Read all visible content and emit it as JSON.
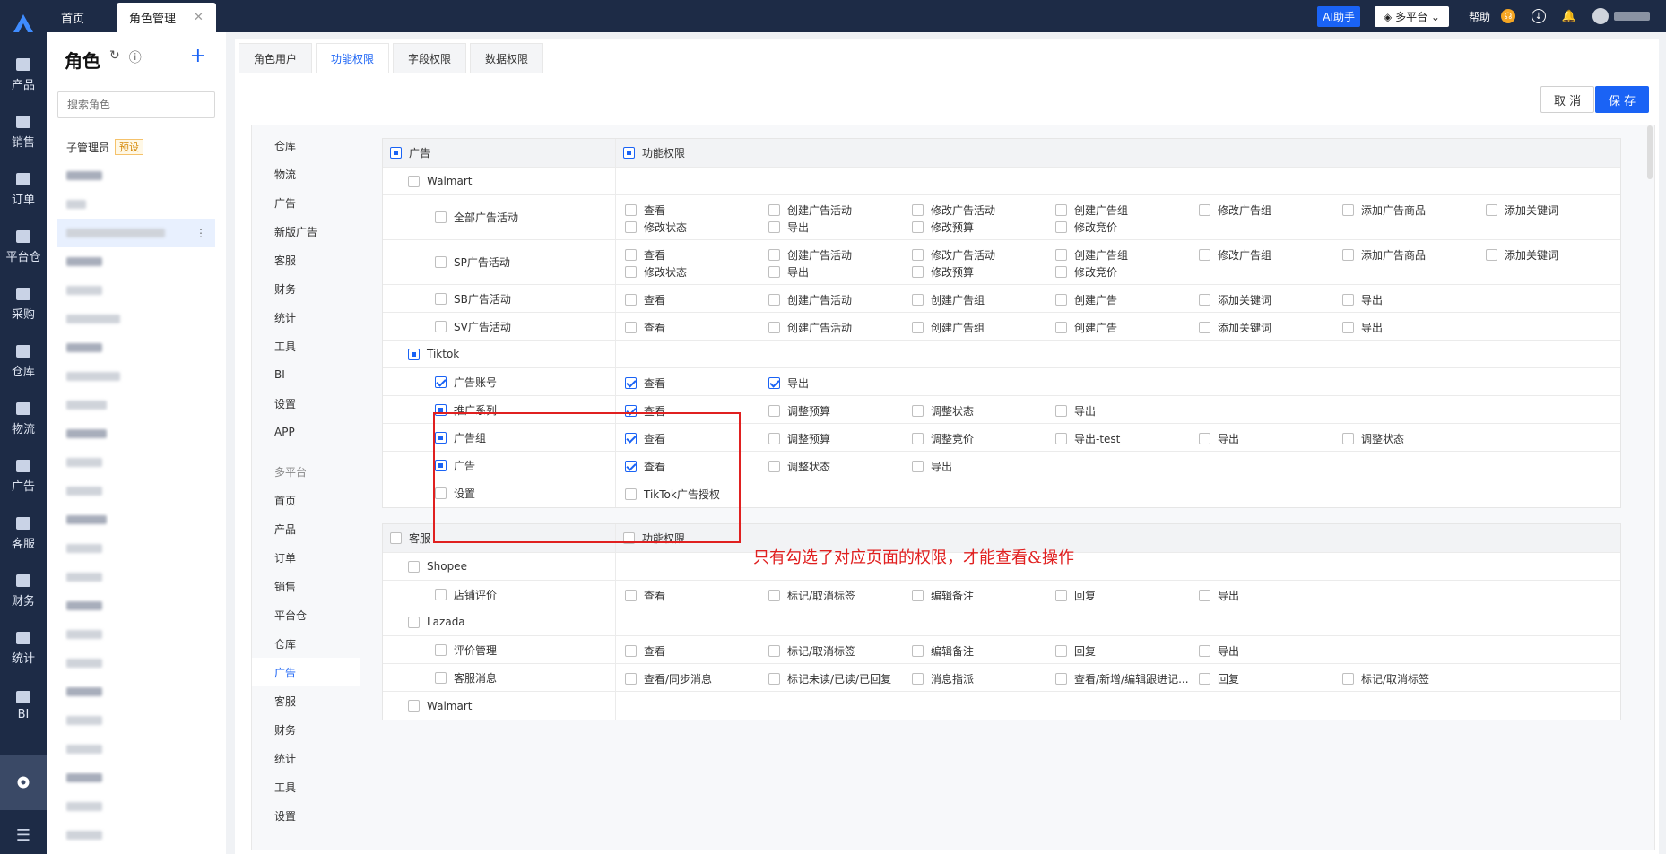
{
  "nav": {
    "items": [
      "产品",
      "销售",
      "订单",
      "平台仓",
      "采购",
      "仓库",
      "物流",
      "广告",
      "客服",
      "财务",
      "统计",
      "BI"
    ]
  },
  "tabs": {
    "home": "首页",
    "role": "角色管理"
  },
  "header": {
    "ai": "AI助手",
    "platform": "多平台",
    "help": "帮助"
  },
  "rolepanel": {
    "title": "角色",
    "search_placeholder": "搜索角色",
    "first_role": "子管理员",
    "first_tag": "预设"
  },
  "subtabs": [
    "角色用户",
    "功能权限",
    "字段权限",
    "数据权限"
  ],
  "buttons": {
    "cancel": "取 消",
    "save": "保 存"
  },
  "categories": [
    "仓库",
    "物流",
    "广告",
    "新版广告",
    "客服",
    "财务",
    "统计",
    "工具",
    "BI",
    "设置",
    "APP"
  ],
  "group_label": "多平台",
  "group_categories": [
    "首页",
    "产品",
    "订单",
    "销售",
    "平台仓",
    "仓库",
    "广告",
    "客服",
    "财务",
    "统计",
    "工具",
    "设置"
  ],
  "ad_section": {
    "head_left": "广告",
    "head_right": "功能权限",
    "rows": [
      {
        "label": "Walmart",
        "level": 1,
        "state": "none",
        "perms": []
      },
      {
        "label": "全部广告活动",
        "level": 2,
        "state": "none",
        "lines": 2,
        "perms": [
          "查看",
          "创建广告活动",
          "修改广告活动",
          "创建广告组",
          "修改广告组",
          "添加广告商品",
          "添加关键词",
          "修改状态",
          "导出",
          "修改预算",
          "修改竞价"
        ]
      },
      {
        "label": "SP广告活动",
        "level": 2,
        "state": "none",
        "lines": 2,
        "perms": [
          "查看",
          "创建广告活动",
          "修改广告活动",
          "创建广告组",
          "修改广告组",
          "添加广告商品",
          "添加关键词",
          "修改状态",
          "导出",
          "修改预算",
          "修改竞价"
        ]
      },
      {
        "label": "SB广告活动",
        "level": 2,
        "state": "none",
        "perms": [
          "查看",
          "创建广告活动",
          "创建广告组",
          "创建广告",
          "添加关键词",
          "导出"
        ]
      },
      {
        "label": "SV广告活动",
        "level": 2,
        "state": "none",
        "perms": [
          "查看",
          "创建广告活动",
          "创建广告组",
          "创建广告",
          "添加关键词",
          "导出"
        ]
      },
      {
        "label": "Tiktok",
        "level": 1,
        "state": "half",
        "perms": []
      },
      {
        "label": "广告账号",
        "level": 2,
        "state": "check",
        "perms": [
          "查看",
          "导出"
        ],
        "checked": [
          0,
          1
        ]
      },
      {
        "label": "推广系列",
        "level": 2,
        "state": "half",
        "perms": [
          "查看",
          "调整预算",
          "调整状态",
          "导出"
        ],
        "checked": [
          0
        ]
      },
      {
        "label": "广告组",
        "level": 2,
        "state": "half",
        "perms": [
          "查看",
          "调整预算",
          "调整竞价",
          "导出-test",
          "导出",
          "调整状态"
        ],
        "checked": [
          0
        ]
      },
      {
        "label": "广告",
        "level": 2,
        "state": "half",
        "perms": [
          "查看",
          "调整状态",
          "导出"
        ],
        "checked": [
          0
        ]
      },
      {
        "label": "设置",
        "level": 2,
        "state": "none",
        "perms": [
          "TikTok广告授权"
        ]
      }
    ]
  },
  "annotation": "只有勾选了对应页面的权限，才能查看&操作",
  "cs_section": {
    "head_left": "客服",
    "head_right": "功能权限",
    "rows": [
      {
        "label": "Shopee",
        "level": 1,
        "state": "none",
        "perms": []
      },
      {
        "label": "店铺评价",
        "level": 2,
        "state": "none",
        "perms": [
          "查看",
          "标记/取消标签",
          "编辑备注",
          "回复",
          "导出"
        ]
      },
      {
        "label": "Lazada",
        "level": 1,
        "state": "none",
        "perms": []
      },
      {
        "label": "评价管理",
        "level": 2,
        "state": "none",
        "perms": [
          "查看",
          "标记/取消标签",
          "编辑备注",
          "回复",
          "导出"
        ]
      },
      {
        "label": "客服消息",
        "level": 2,
        "state": "none",
        "perms": [
          "查看/同步消息",
          "标记未读/已读/已回复",
          "消息指派",
          "查看/新增/编辑跟进记...",
          "回复",
          "标记/取消标签"
        ]
      },
      {
        "label": "Walmart",
        "level": 1,
        "state": "none",
        "perms": []
      }
    ]
  }
}
